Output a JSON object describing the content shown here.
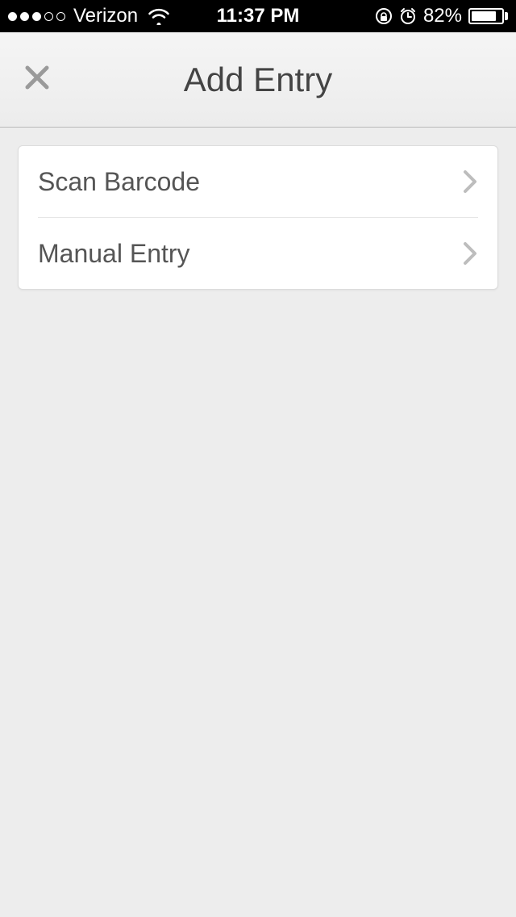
{
  "status_bar": {
    "carrier": "Verizon",
    "time": "11:37 PM",
    "battery_percent": "82%",
    "battery_fill_pct": 82
  },
  "header": {
    "title": "Add Entry"
  },
  "options": [
    {
      "label": "Scan Barcode"
    },
    {
      "label": "Manual Entry"
    }
  ]
}
